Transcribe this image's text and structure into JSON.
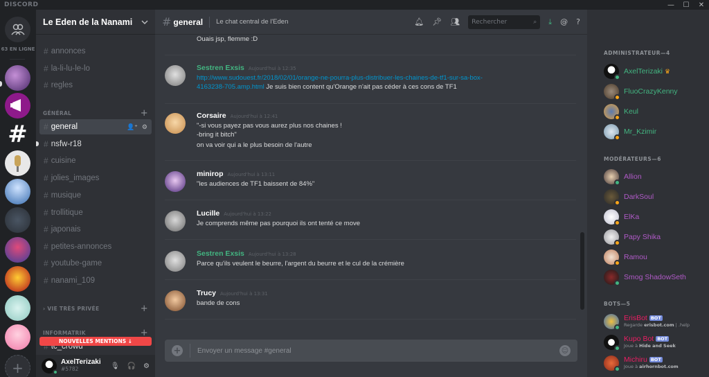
{
  "titlebar": {
    "brand": "DISCORD",
    "min": "—",
    "max": "☐",
    "close": "✕"
  },
  "guild_rail": {
    "online_count": "63 EN LIGNE"
  },
  "server": {
    "name": "Le Eden de la Nanami"
  },
  "channels_top": [
    {
      "name": "annonces"
    },
    {
      "name": "la-li-lu-le-lo"
    },
    {
      "name": "regles"
    }
  ],
  "category_general": "GÉNÉRAL",
  "channels_general": [
    {
      "name": "general"
    },
    {
      "name": "nsfw-r18"
    },
    {
      "name": "cuisine"
    },
    {
      "name": "jolies_images"
    },
    {
      "name": "musique"
    },
    {
      "name": "trollitique"
    },
    {
      "name": "japonais"
    },
    {
      "name": "petites-annonces"
    },
    {
      "name": "youtube-game"
    },
    {
      "name": "nanami_109"
    }
  ],
  "category_private": "VIE TRÈS PRIVÉE",
  "category_informatik": "INFORMATRIK",
  "partial_channel": "tc_crowd",
  "new_mentions": "NOUVELLES MENTIONS ↓",
  "user": {
    "name": "AxelTerizaki",
    "tag": "#5782"
  },
  "chat": {
    "channel": "general",
    "topic": "Le chat central de l'Eden",
    "search_placeholder": "Rechercher",
    "composer_placeholder": "Envoyer un message #general"
  },
  "messages": [
    {
      "continuation": true,
      "lines": [
        "Ouais jsp, flemme :D"
      ]
    },
    {
      "author": "Sestren Exsis",
      "color": "#43b581",
      "time": "Aujourd'hui à 12:35",
      "link1": "http://www.sudouest.fr/2018/02/01/orange-ne-pourra-plus-distribuer-les-chaines-de-tf1-sur-sa-box-",
      "link2": "4163238-705.amp.html",
      "after_link": " Je suis bien content qu'Orange n'ait pas céder à ces cons de TF1"
    },
    {
      "author": "Corsaire",
      "color": "#ffffff",
      "time": "Aujourd'hui à 12:41",
      "lines": [
        "\"-si vous payez pas vous aurez plus nos chaines !",
        "-bring it bitch\"",
        "on va voir qui a le plus besoin de l'autre"
      ]
    },
    {
      "author": "minirop",
      "color": "#ffffff",
      "time": "Aujourd'hui à 13:11",
      "lines": [
        "\"les audiences de TF1 baissent de 84%\""
      ]
    },
    {
      "author": "Lucille",
      "color": "#ffffff",
      "time": "Aujourd'hui à 13:22",
      "lines": [
        "Je comprends même pas pourquoi ils ont tenté ce move"
      ]
    },
    {
      "author": "Sestren Exsis",
      "color": "#43b581",
      "time": "Aujourd'hui à 13:28",
      "lines": [
        "Parce qu'ils veulent le beurre, l'argent du beurre et le cul de la crémière"
      ]
    },
    {
      "author": "Trucy",
      "color": "#ffffff",
      "time": "Aujourd'hui à 13:31",
      "lines": [
        "bande de cons"
      ]
    }
  ],
  "members": {
    "admin_header": "ADMINISTRATEUR—4",
    "admins": [
      {
        "name": "AxelTerizaki",
        "color": "#43b581",
        "crown": "♛",
        "status": "#43b581"
      },
      {
        "name": "FluoCrazyKenny",
        "color": "#43b581",
        "status": "#faa61a"
      },
      {
        "name": "Keul",
        "color": "#43b581",
        "status": "#faa61a"
      },
      {
        "name": "Mr_Kzimir",
        "color": "#43b581",
        "status": "#faa61a"
      }
    ],
    "mod_header": "MODÉRATEURS—6",
    "mods": [
      {
        "name": "Allion",
        "color": "#b05ac7",
        "status": "#43b581"
      },
      {
        "name": "DarkSoul",
        "color": "#b05ac7",
        "status": "#faa61a"
      },
      {
        "name": "ElKa",
        "color": "#b05ac7",
        "status": "#faa61a"
      },
      {
        "name": "Papy Shika",
        "color": "#b05ac7",
        "status": "#faa61a"
      },
      {
        "name": "Ramou",
        "color": "#b05ac7",
        "status": "#faa61a"
      },
      {
        "name": "Smog ShadowSeth",
        "color": "#b05ac7",
        "status": "#43b581"
      }
    ],
    "bots_header": "BOTS—5",
    "bots": [
      {
        "name": "ErisBot",
        "color": "#e91e63",
        "tag": "BOT",
        "sub_prefix": "Regarde ",
        "sub_bold": "erisbot.com",
        "sub_suffix": " | .help",
        "status": "#43b581"
      },
      {
        "name": "Kupo Bot",
        "color": "#e91e63",
        "tag": "BOT",
        "sub_prefix": "Joue à ",
        "sub_bold": "Hide and Seek",
        "sub_suffix": "",
        "status": "#43b581"
      },
      {
        "name": "Michiru",
        "color": "#e91e63",
        "tag": "BOT",
        "sub_prefix": "Joue à ",
        "sub_bold": "airhornbot.com",
        "sub_suffix": "",
        "status": "#43b581"
      }
    ]
  }
}
